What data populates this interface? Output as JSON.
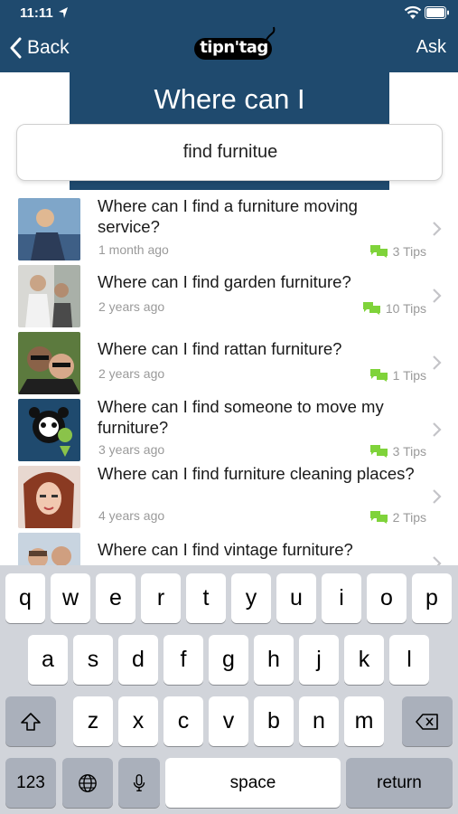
{
  "status": {
    "time": "11:11"
  },
  "nav": {
    "back_label": "Back",
    "logo_text": "tipn'tag",
    "ask_label": "Ask"
  },
  "header": {
    "title": "Where can I"
  },
  "search": {
    "value": "find furnitue"
  },
  "questions": [
    {
      "title": "Where can I find a furniture moving service?",
      "ago": "1 month ago",
      "tips": "3 Tips"
    },
    {
      "title": "Where can I find garden furniture?",
      "ago": "2 years ago",
      "tips": "10 Tips"
    },
    {
      "title": "Where can I find rattan furniture?",
      "ago": "2 years ago",
      "tips": "1 Tips"
    },
    {
      "title": "Where can I find someone to move my furniture?",
      "ago": "3 years ago",
      "tips": "3 Tips"
    },
    {
      "title": "Where can I find furniture cleaning places?",
      "ago": "4 years ago",
      "tips": "2 Tips"
    },
    {
      "title": "Where can I find vintage furniture?",
      "ago": "",
      "tips": ""
    }
  ],
  "keyboard": {
    "row1": [
      "q",
      "w",
      "e",
      "r",
      "t",
      "y",
      "u",
      "i",
      "o",
      "p"
    ],
    "row2": [
      "a",
      "s",
      "d",
      "f",
      "g",
      "h",
      "j",
      "k",
      "l"
    ],
    "row3": [
      "z",
      "x",
      "c",
      "v",
      "b",
      "n",
      "m"
    ],
    "numbers_label": "123",
    "space_label": "space",
    "return_label": "return"
  },
  "colors": {
    "brand": "#1f4a6e",
    "tip_icon": "#7fd33a",
    "meta_text": "#9a9a9a"
  }
}
